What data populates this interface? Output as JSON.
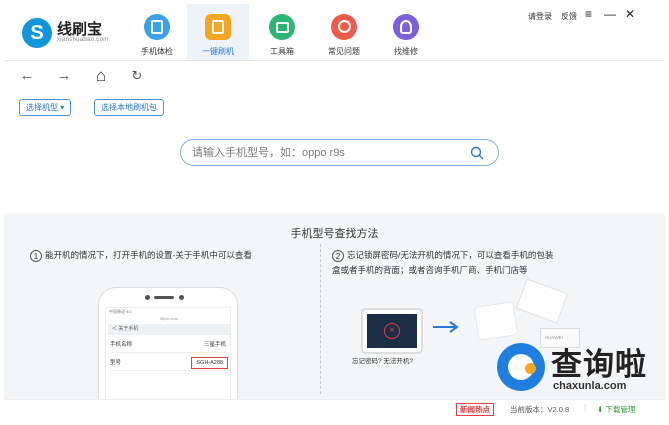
{
  "app": {
    "logo_glyph": "S",
    "name": "线刷宝",
    "url": "xianshuabao.com"
  },
  "nav": {
    "items": [
      {
        "label": "手机体检",
        "icon": "phone-check-icon",
        "color": "#3aa0e8"
      },
      {
        "label": "一键刷机",
        "icon": "one-key-flash-icon",
        "color": "#f5a623"
      },
      {
        "label": "工具箱",
        "icon": "toolbox-icon",
        "color": "#2bb673"
      },
      {
        "label": "常见问题",
        "icon": "faq-icon",
        "color": "#f05a4a"
      },
      {
        "label": "找维修",
        "icon": "repair-icon",
        "color": "#7b61d9"
      }
    ],
    "active": "一键刷机"
  },
  "topbar": {
    "login": "请登录",
    "feedback": "反馈",
    "menu_glyph": "≡",
    "minimize_glyph": "—",
    "close_glyph": "✕"
  },
  "browser": {
    "back_glyph": "←",
    "forward_glyph": "→",
    "home_glyph": "⌂",
    "refresh_glyph": "↻"
  },
  "filters": {
    "model_select": "选择机型",
    "select_arrow": "▾",
    "local_package": "选择本地刷机包"
  },
  "search": {
    "placeholder": "请输入手机型号，如：oppo r9s",
    "icon": "search-icon"
  },
  "guide": {
    "title": "手机型号查找方法",
    "step1_num": "1",
    "step1_text": "能开机的情况下，打开手机的设置-关于手机中可以查看",
    "step2_num": "2",
    "step2_text_line1": "忘记锁屏密码/无法开机的情况下，可以查看手机的包装",
    "step2_text_line2": "盒或者手机的背面；或者咨询手机厂商、手机门店等",
    "phone_status": "中国移动 4G",
    "phone_url": "58pic.com",
    "phone_back": "＜ 关于手机",
    "phone_row1_label": "手机名称",
    "phone_row1_value": "三星手机",
    "phone_row2_label": "型号",
    "phone_row2_value": "SGH-A288",
    "forgot_caption": "忘记密码? 无法开机?",
    "box_brand": "HUAWEI"
  },
  "watermark": {
    "text": "查询啦",
    "url": "chaxunla.com"
  },
  "statusbar": {
    "news_badge": "新闻热点",
    "version_label": "当前版本：V2.0.8",
    "separator": "|",
    "download_manager": "⬇ 下载管理"
  },
  "colors": {
    "accent": "#2878d6",
    "panel_bg": "#f3f5f7",
    "alert_red": "#e04040",
    "download_green": "#2a9d3a"
  }
}
